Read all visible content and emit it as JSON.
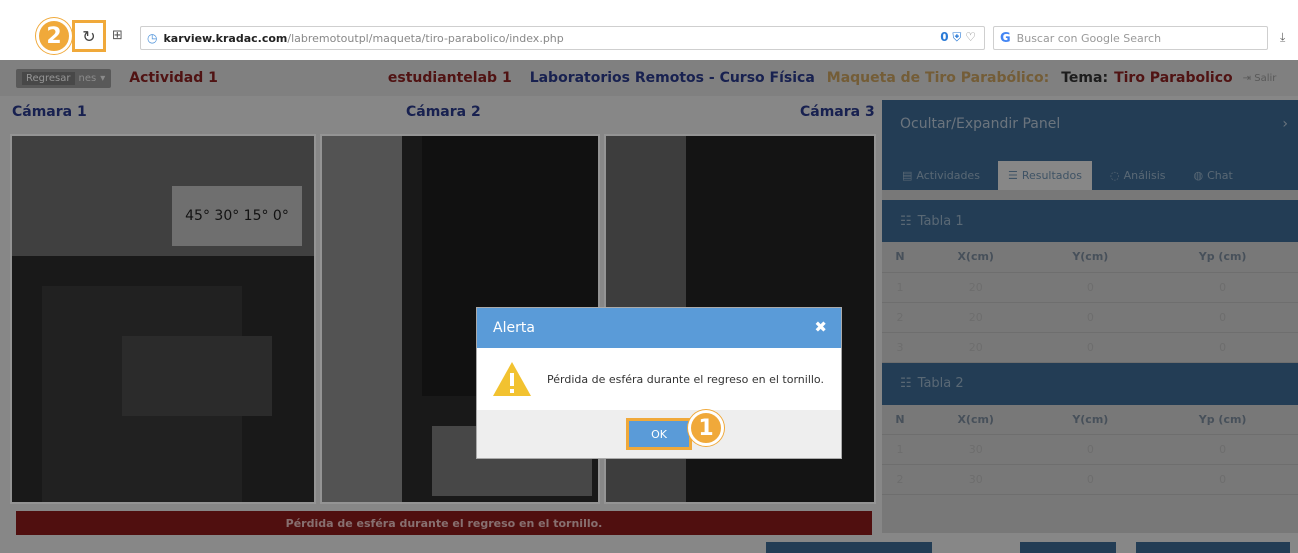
{
  "browser": {
    "url_domain": "karview.kradac.com",
    "url_path": "/labremotoutpl/maqueta/tiro-parabolico/index.php",
    "url_badge_count": "0",
    "search_placeholder": "Buscar con Google Search"
  },
  "steps": {
    "step1": "1",
    "step2": "2"
  },
  "topnav": {
    "menu_label": "Regresar",
    "menu_suffix": "nes",
    "activity": "Actividad 1",
    "user": "estudiantelab 1",
    "course": "Laboratorios Remotos - Curso Física",
    "maqueta": "Maqueta de Tiro Parabólico:",
    "tema_label": "Tema:",
    "tema_value": "Tiro Parabolico",
    "salir": "Salir"
  },
  "cameras": [
    {
      "title": "Cámara 1"
    },
    {
      "title": "Cámara 2"
    },
    {
      "title": "Cámara 3"
    }
  ],
  "camera_board_text": "45° 30° 15° 0°",
  "status_message": "Pérdida de esféra durante el regreso en el tornillo.",
  "panel": {
    "toggle_label": "Ocultar/Expandir Panel",
    "tabs": [
      "Actividades",
      "Resultados",
      "Análisis",
      "Chat"
    ],
    "active_tab": "Resultados",
    "tables": [
      {
        "title": "Tabla 1",
        "headers": [
          "N",
          "X(cm)",
          "Y(cm)",
          "Yp (cm)"
        ],
        "rows": [
          [
            "1",
            "20",
            "0",
            "0"
          ],
          [
            "2",
            "20",
            "0",
            "0"
          ],
          [
            "3",
            "20",
            "0",
            "0"
          ]
        ]
      },
      {
        "title": "Tabla 2",
        "headers": [
          "N",
          "X(cm)",
          "Y(cm)",
          "Yp (cm)"
        ],
        "rows": [
          [
            "1",
            "30",
            "0",
            "0"
          ],
          [
            "2",
            "30",
            "0",
            "0"
          ]
        ]
      }
    ]
  },
  "dialog": {
    "title": "Alerta",
    "message": "Pérdida de esféra durante el regreso en el tornillo.",
    "ok_label": "OK"
  },
  "colors": {
    "accent_orange": "#f0a93a",
    "dialog_blue": "#5a9bd8",
    "panel_blue": "#3d6a93",
    "status_red": "#8b1a1a"
  }
}
